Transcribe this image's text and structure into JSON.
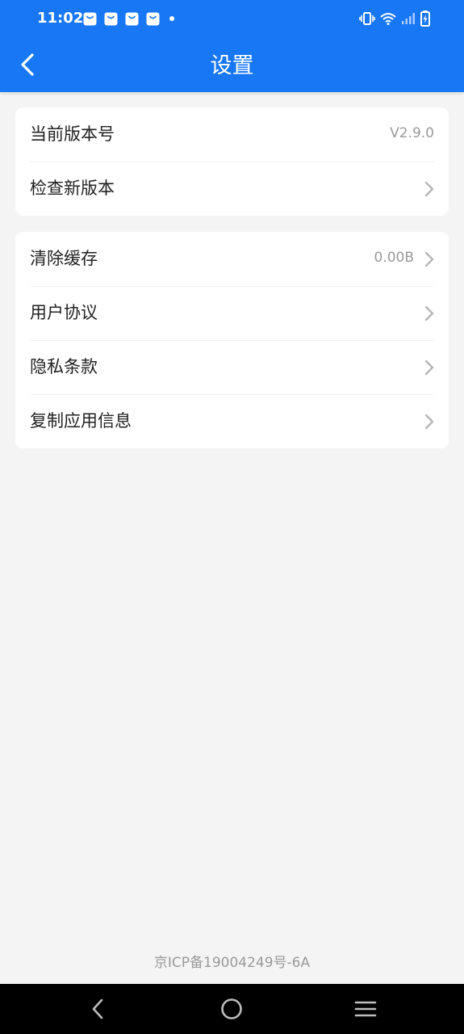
{
  "status_bar": {
    "time": "11:02",
    "notification_icons": [
      "shopping-bag-icon",
      "shopping-bag-icon",
      "shopping-bag-icon",
      "shopping-bag-icon",
      "dot-icon"
    ],
    "system_icons": [
      "vibrate-icon",
      "wifi-icon",
      "signal-icon",
      "battery-charging-icon"
    ]
  },
  "header": {
    "title": "设置",
    "back_icon": "back-arrow-icon",
    "color": "#1877f5"
  },
  "version_card": {
    "items": [
      {
        "label": "当前版本号",
        "value": "V2.9.0"
      },
      {
        "label": "检查新版本",
        "chevron": true
      }
    ]
  },
  "settings_card": {
    "items": [
      {
        "label": "清除缓存",
        "value": "0.00B",
        "chevron": true
      },
      {
        "label": "用户协议",
        "chevron": true
      },
      {
        "label": "隐私条款",
        "chevron": true
      },
      {
        "label": "复制应用信息",
        "chevron": true
      }
    ]
  },
  "footer": {
    "icp": "京ICP备19004249号-6A"
  },
  "nav_bar": {
    "buttons": [
      "back-triangle-icon",
      "home-circle-icon",
      "menu-lines-icon"
    ]
  }
}
